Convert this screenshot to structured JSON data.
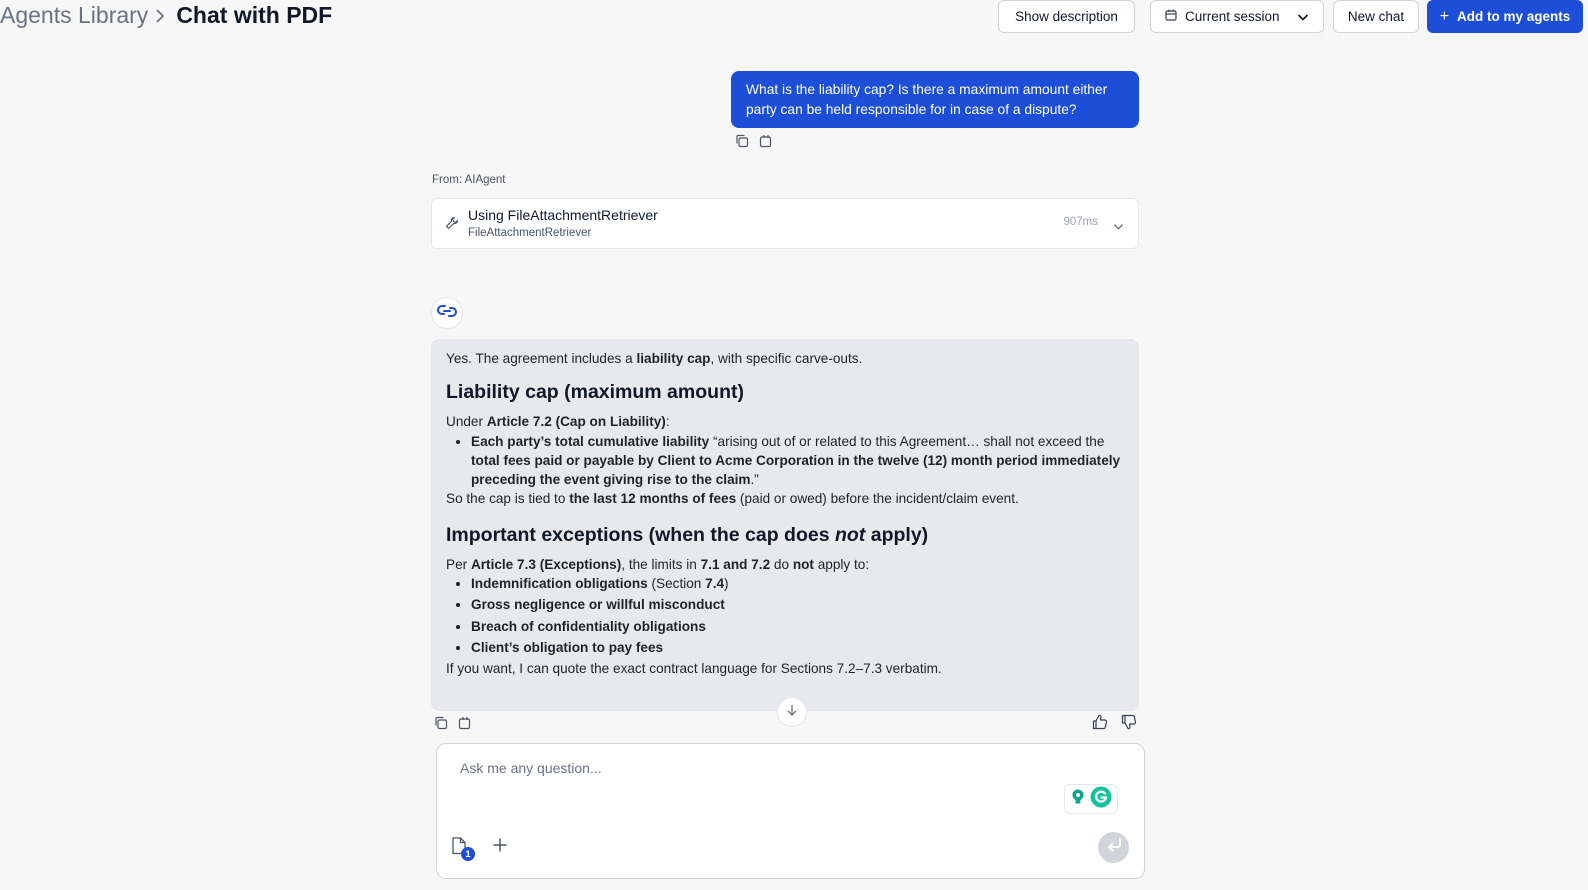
{
  "breadcrumb": {
    "parent": "Agents Library",
    "separator": ">",
    "current": "Chat with PDF"
  },
  "header_actions": {
    "show_description": "Show description",
    "session": "Current session",
    "new_chat": "New chat",
    "add_to_agents": "Add to my agents"
  },
  "user_message": "What is the liability cap? Is there a maximum amount either party can be held responsible for in case of a dispute?",
  "tool_call": {
    "from_label": "From: AIAgent",
    "title": "Using FileAttachmentRetriever",
    "subtitle": "FileAttachmentRetriever",
    "duration": "907ms"
  },
  "answer": {
    "intro_1": "Yes. The agreement includes a ",
    "intro_bold": "liability cap",
    "intro_2": ", with specific carve-outs.",
    "heading_cap": "Liability cap (maximum amount)",
    "under_1": "Under ",
    "under_bold": "Article 7.2 (Cap on Liability)",
    "under_2": ":",
    "cap_b1": "Each party’s total cumulative liability",
    "cap_t1": " “arising out of or related to this Agreement… shall not exceed the ",
    "cap_b2": "total fees paid or payable by Client to Acme Corporation in the twelve (12) month period immediately preceding the event giving rise to the claim",
    "cap_t2": ".”",
    "so_1": "So the cap is tied to ",
    "so_bold": "the last 12 months of fees",
    "so_2": " (paid or owed) before the incident/claim event.",
    "heading_exc_1": "Important exceptions (when the cap does ",
    "heading_exc_em": "not",
    "heading_exc_2": " apply)",
    "per_1": "Per ",
    "per_b1": "Article 7.3 (Exceptions)",
    "per_2": ", the limits in ",
    "per_b2": "7.1 and 7.2",
    "per_3": " do ",
    "per_b3": "not",
    "per_4": " apply to:",
    "exc1_bold": "Indemnification obligations",
    "exc1_text": " (Section ",
    "exc1_sec": "7.4",
    "exc1_end": ")",
    "exc2": "Gross negligence or willful misconduct",
    "exc3": "Breach of confidentiality obligations",
    "exc4": "Client’s obligation to pay fees",
    "outro": "If you want, I can quote the exact contract language for Sections 7.2–7.3 verbatim."
  },
  "composer": {
    "placeholder": "Ask me any question...",
    "attachment_count": "1"
  },
  "icons": {
    "copy": "copy-icon",
    "edit": "edit-icon",
    "thumbs_up": "thumbs-up-icon",
    "thumbs_down": "thumbs-down-icon",
    "tool": "wrench-icon",
    "calendar": "calendar-icon",
    "scroll_down": "arrow-down-icon",
    "send": "send-icon",
    "attach": "document-icon",
    "add": "plus-icon",
    "agent": "agent-logo-icon"
  },
  "colors": {
    "accent": "#1d4ed8",
    "answer_bg": "#e8e9ed",
    "page_bg": "#f7f7f8"
  }
}
